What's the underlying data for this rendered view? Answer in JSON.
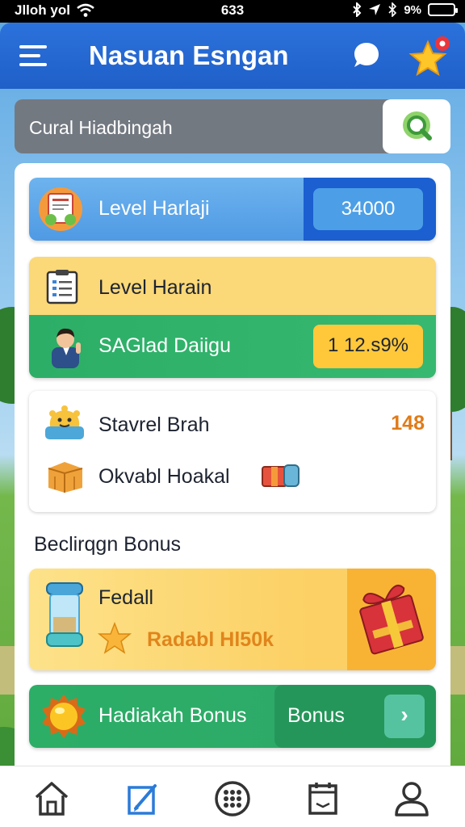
{
  "status_bar": {
    "carrier": "Jlloh yol",
    "time": "633",
    "battery": "9%"
  },
  "app_bar": {
    "title": "Nasuan Esngan",
    "icons": [
      "menu-icon",
      "chat-bubble-icon",
      "star-notification-icon"
    ]
  },
  "search": {
    "placeholder": "Cural Hiadbingah",
    "icon": "search-icon"
  },
  "cards": {
    "level_harlaji": {
      "label": "Level Harlaji",
      "value": "34000",
      "icon": "certificate-icon"
    },
    "level_harain": {
      "label": "Level Harain",
      "icon": "clipboard-icon"
    },
    "saglad": {
      "label": "SAGlad Daiigu",
      "value": "1 12.s9%",
      "icon": "student-avatar-icon"
    },
    "stavrel": {
      "label": "Stavrel Brah",
      "count": "148",
      "icon": "mascot-icon"
    },
    "okvabl": {
      "label": "Okvabl Hoakal",
      "icon": "crate-icon",
      "extra_icon": "parcel-icon"
    }
  },
  "bonus_section": {
    "title": "Beclirqgn Bonus",
    "fedall": {
      "label": "Fedall",
      "sub_label": "Radabl Hl50k",
      "icon": "hourglass-icon",
      "sub_icon": "star-icon",
      "gift_icon": "gift-box-icon"
    },
    "hadiakah": {
      "label": "Hadiakah Bonus",
      "button_label": "Bonus",
      "icon": "gold-coin-icon",
      "arrow_icon": "chevron-right-icon"
    }
  },
  "bottom_nav": {
    "items": [
      "home-icon",
      "edit-icon",
      "grid-menu-icon",
      "calendar-icon",
      "profile-icon"
    ],
    "active": "edit-icon"
  },
  "colors": {
    "app_bar": "#1f5fc8",
    "accent_green": "#2cae67",
    "accent_yellow": "#fbd878",
    "accent_orange": "#e07b18"
  }
}
